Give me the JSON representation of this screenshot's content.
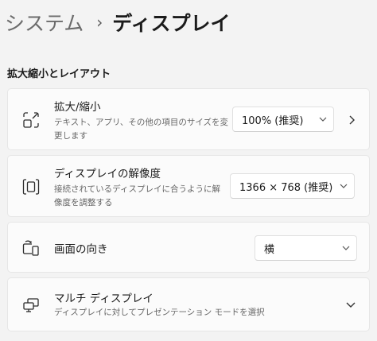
{
  "breadcrumb": {
    "parent": "システム",
    "separator": "›",
    "current": "ディスプレイ"
  },
  "section": {
    "title": "拡大縮小とレイアウト"
  },
  "scale": {
    "title": "拡大/縮小",
    "desc_line1": "テキスト、アプリ、その他の項目のサイズを変",
    "desc_line2": "更します",
    "value": "100% (推奨)",
    "icon": "scale-icon"
  },
  "resolution": {
    "title": "ディスプレイの解像度",
    "desc_line1": "接続されているディスプレイに合うように解",
    "desc_line2": "像度を調整する",
    "value": "1366 × 768 (推奨)",
    "icon": "resolution-icon"
  },
  "orientation": {
    "title": "画面の向き",
    "value": "横",
    "icon": "orientation-icon"
  },
  "multi_display": {
    "title": "マルチ ディスプレイ",
    "desc": "ディスプレイに対してプレゼンテーション モードを選択",
    "icon": "multi-display-icon"
  }
}
